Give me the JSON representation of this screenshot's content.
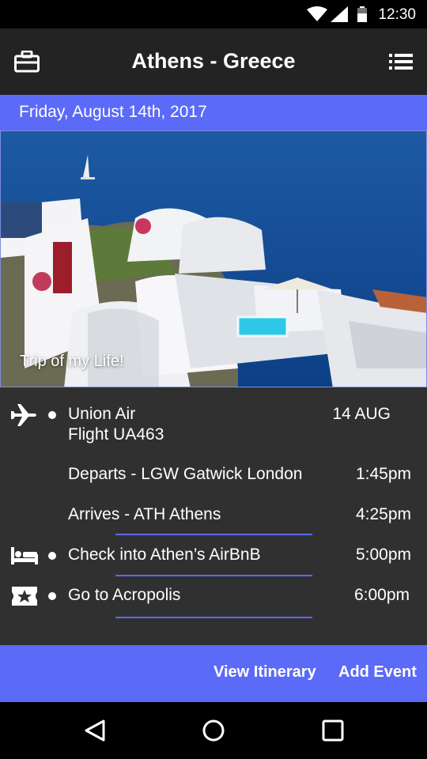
{
  "status_bar": {
    "time": "12:30"
  },
  "app_bar": {
    "title": "Athens - Greece",
    "left_icon": "briefcase-icon",
    "right_icon": "list-menu-icon"
  },
  "date": "Friday, August 14th, 2017",
  "hero": {
    "caption": "Trip of my Life!"
  },
  "itinerary": {
    "flight": {
      "icon": "airplane-icon",
      "airline": "Union Air",
      "flight_number": "Flight UA463",
      "date": "14 AUG",
      "departs": "Departs - LGW Gatwick London",
      "departs_time": "1:45pm",
      "arrives": "Arrives - ATH Athens",
      "arrives_time": "4:25pm"
    },
    "hotel": {
      "icon": "bed-icon",
      "label": "Check into Athen’s AirBnB",
      "time": "5:00pm"
    },
    "event": {
      "icon": "ticket-star-icon",
      "label": "Go to Acropolis",
      "time": "6:00pm"
    }
  },
  "actions": {
    "view_itinerary": "View Itinerary",
    "add_event": "Add Event"
  },
  "colors": {
    "accent": "#5b6af7",
    "background": "#303030",
    "app_bar": "#232323"
  }
}
